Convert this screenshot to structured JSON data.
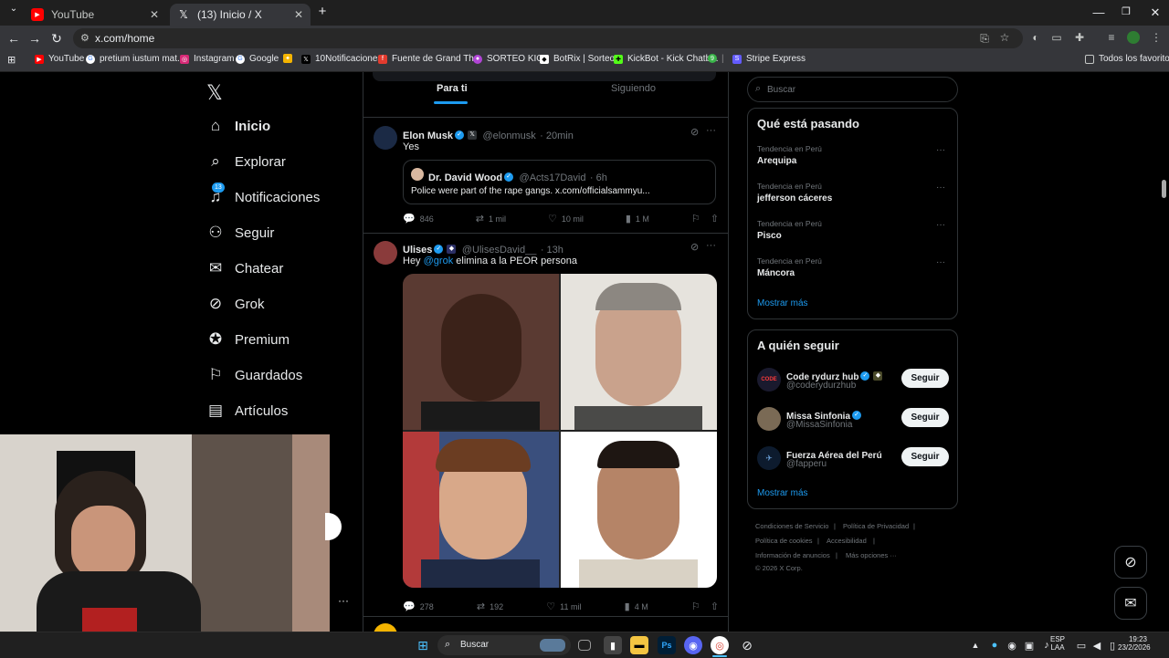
{
  "browser": {
    "tabs": [
      {
        "label": "YouTube",
        "active": false,
        "icon": "youtube-icon"
      },
      {
        "label": "(13) Inicio / X",
        "active": true,
        "icon": "x-logo-icon"
      }
    ],
    "new_tab": "+",
    "url": "x.com/home",
    "bookmarks": [
      {
        "label": "YouTube",
        "color": "#ff0000"
      },
      {
        "label": "pretium iustum mat...",
        "color": "#4285f4"
      },
      {
        "label": "Instagram",
        "color": "#d62976"
      },
      {
        "label": "Google",
        "color": "#4285f4"
      },
      {
        "label": "",
        "color": "#f4b400"
      },
      {
        "label": "10Notificaciones",
        "color": "#000000"
      },
      {
        "label": "Fuente de Grand Th...",
        "color": "#e23b2e"
      },
      {
        "label": "SORTEO KICK",
        "color": "#b145d6"
      },
      {
        "label": "BotRix | Sorteos",
        "color": "#ffffff"
      },
      {
        "label": "KickBot - Kick Chatb...",
        "color": "#53fc18"
      },
      {
        "label": "",
        "color": "#3ab54a"
      },
      {
        "label": "Stripe Express",
        "color": "#635bff"
      }
    ],
    "other_bookmarks": "Todos los favoritos"
  },
  "nav": {
    "items": [
      {
        "label": "Inicio",
        "icon": "home-icon"
      },
      {
        "label": "Explorar",
        "icon": "search-icon"
      },
      {
        "label": "Notificaciones",
        "icon": "bell-icon",
        "badge": "13"
      },
      {
        "label": "Seguir",
        "icon": "add-user-icon"
      },
      {
        "label": "Chatear",
        "icon": "mail-icon"
      },
      {
        "label": "Grok",
        "icon": "grok-icon"
      },
      {
        "label": "Premium",
        "icon": "premium-icon"
      },
      {
        "label": "Guardados",
        "icon": "bookmark-icon"
      },
      {
        "label": "Artículos",
        "icon": "article-icon"
      }
    ],
    "more": "···"
  },
  "feed": {
    "tabs": [
      "Para ti",
      "Siguiendo"
    ],
    "tweets": [
      {
        "name": "Elon Musk",
        "handle": "@elonmusk",
        "time": "· 20min",
        "text": "Yes",
        "quote": {
          "name": "Dr. David Wood",
          "handle": "@Acts17David",
          "time": "· 6h",
          "text": "Police were part of the rape gangs. x.com/officialsammyu..."
        },
        "replies": "846",
        "reposts": "1 mil",
        "likes": "10 mil",
        "views": "1 M"
      },
      {
        "name": "Ulises",
        "handle": "@UlisesDavid__",
        "time": "· 13h",
        "text_prefix": "Hey ",
        "mention": "@grok",
        "text_suffix": " elimina a la PEOR persona",
        "replies": "278",
        "reposts": "192",
        "likes": "11 mil",
        "views": "4 M"
      }
    ]
  },
  "right": {
    "search_placeholder": "Buscar",
    "trends_title": "Qué está pasando",
    "trends": [
      {
        "context": "Tendencia en Perú",
        "name": "Arequipa"
      },
      {
        "context": "Tendencia en Perú",
        "name": "jefferson cáceres"
      },
      {
        "context": "Tendencia en Perú",
        "name": "Pisco"
      },
      {
        "context": "Tendencia en Perú",
        "name": "Máncora"
      }
    ],
    "show_more": "Mostrar más",
    "follow_title": "A quién seguir",
    "follow": [
      {
        "name": "Code rydurz hub",
        "handle": "@coderydurzhub",
        "button": "Seguir"
      },
      {
        "name": "Missa Sinfonia",
        "handle": "@MissaSinfonia",
        "button": "Seguir"
      },
      {
        "name": "Fuerza Aérea del Perú",
        "handle": "@fapperu",
        "button": "Seguir"
      }
    ],
    "footer": [
      "Condiciones de Servicio",
      "Política de Privacidad",
      "Política de cookies",
      "Accesibilidad",
      "Información de anuncios",
      "Más opciones ···",
      "© 2026 X Corp."
    ]
  },
  "taskbar": {
    "search": "Buscar",
    "lang": "ESP",
    "lang2": "LAA",
    "time": "19:23",
    "date": "23/2/2026"
  },
  "colors": {
    "accent": "#1d9bf0",
    "bg": "#000000",
    "border": "#2f3336"
  }
}
